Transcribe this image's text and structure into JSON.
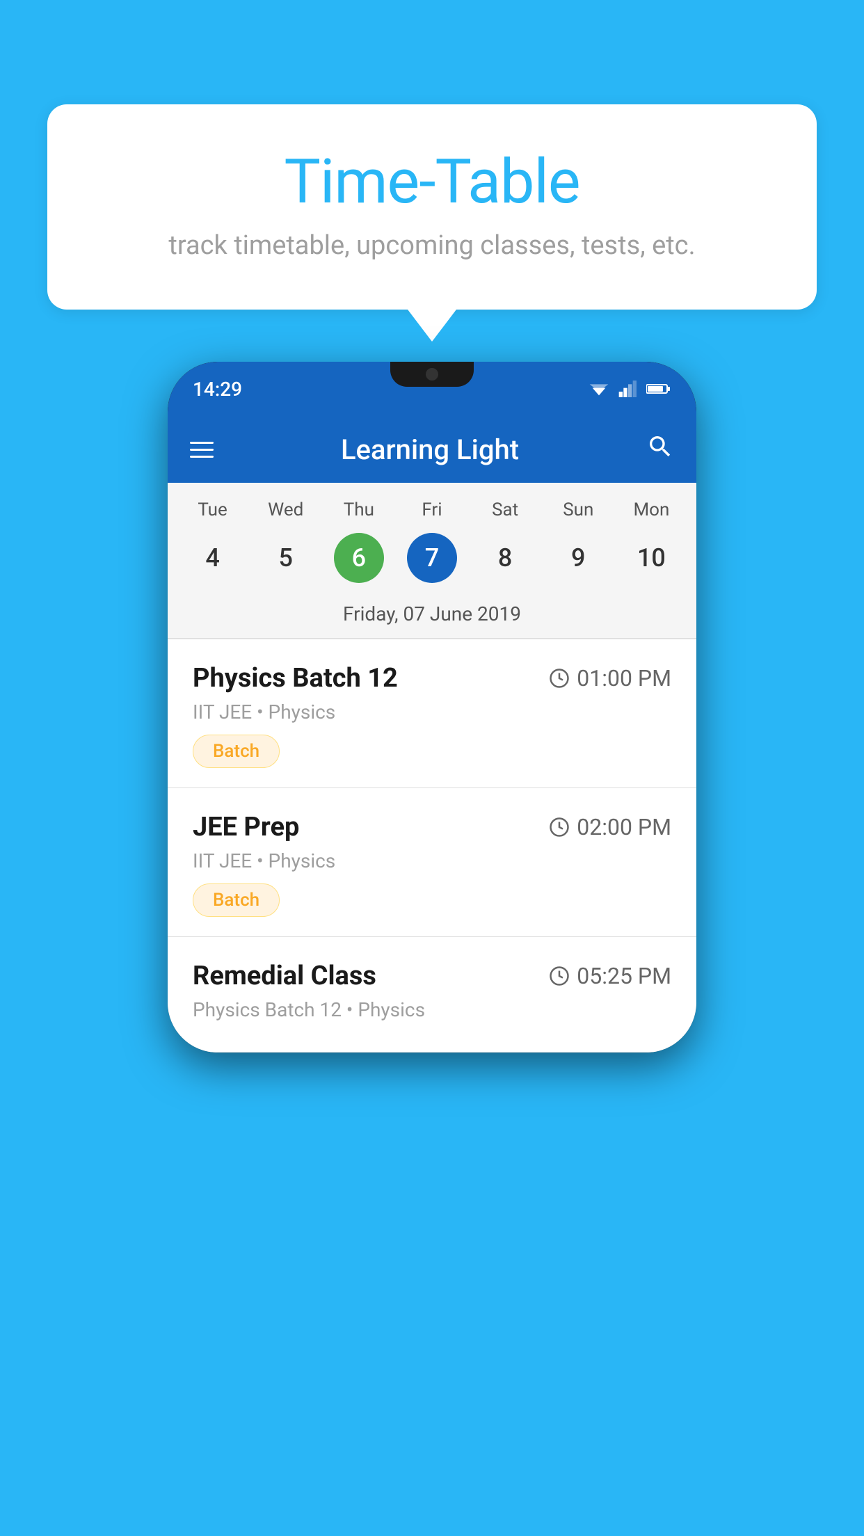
{
  "background_color": "#29B6F6",
  "bubble": {
    "title": "Time-Table",
    "subtitle": "track timetable, upcoming classes, tests, etc."
  },
  "status_bar": {
    "time": "14:29"
  },
  "app_header": {
    "title": "Learning Light"
  },
  "calendar": {
    "days_of_week": [
      "Tue",
      "Wed",
      "Thu",
      "Fri",
      "Sat",
      "Sun",
      "Mon"
    ],
    "dates": [
      "4",
      "5",
      "6",
      "7",
      "8",
      "9",
      "10"
    ],
    "today_index": 2,
    "selected_index": 3,
    "selected_date_label": "Friday, 07 June 2019"
  },
  "schedule": [
    {
      "title": "Physics Batch 12",
      "time": "01:00 PM",
      "subtitle": "IIT JEE • Physics",
      "badge": "Batch"
    },
    {
      "title": "JEE Prep",
      "time": "02:00 PM",
      "subtitle": "IIT JEE • Physics",
      "badge": "Batch"
    },
    {
      "title": "Remedial Class",
      "time": "05:25 PM",
      "subtitle": "Physics Batch 12 • Physics",
      "badge": null
    }
  ],
  "icons": {
    "hamburger": "menu",
    "search": "search",
    "clock": "clock"
  }
}
